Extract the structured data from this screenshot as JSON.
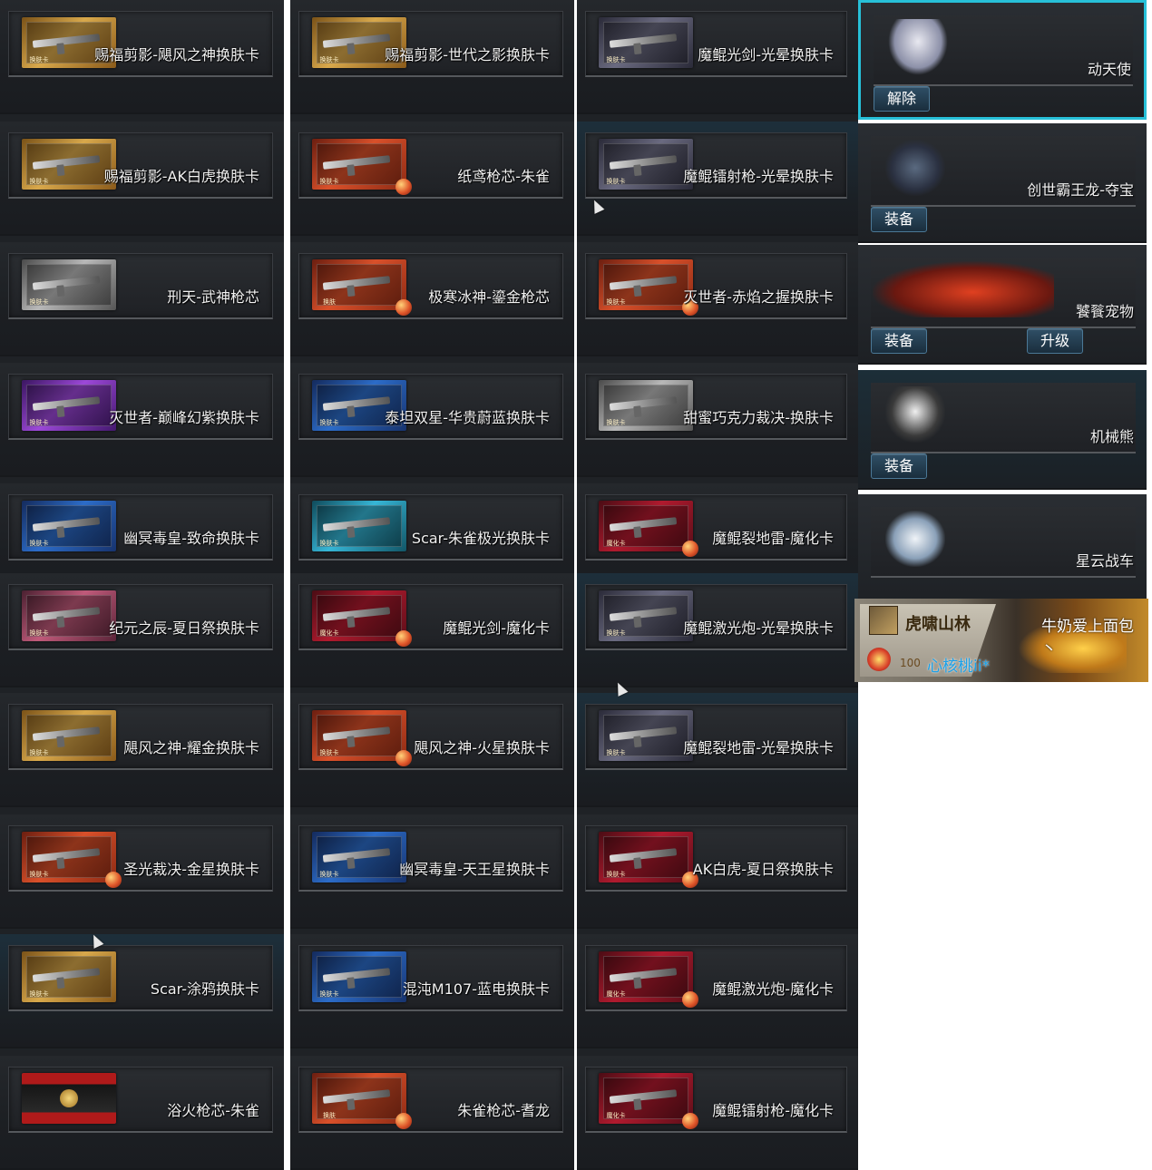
{
  "columns": [
    [
      {
        "label": "赐福剪影-飓风之神换肤卡",
        "theme": "gold",
        "tag": "换肤卡"
      },
      {
        "label": "赐福剪影-AK白虎换肤卡",
        "theme": "gold",
        "tag": "换肤卡"
      },
      {
        "label": "刑天-武神枪芯",
        "theme": "silver",
        "tag": "换肤卡"
      },
      {
        "label": "灭世者-巅峰幻紫换肤卡",
        "theme": "purple",
        "tag": "换肤卡"
      },
      {
        "label": "幽冥毒皇-致命换肤卡",
        "theme": "blue",
        "tag": "换肤卡"
      },
      {
        "label": "纪元之辰-夏日祭换肤卡",
        "theme": "pink",
        "tag": "换肤卡"
      },
      {
        "label": "飓风之神-耀金换肤卡",
        "theme": "gold",
        "tag": "换肤卡"
      },
      {
        "label": "圣光裁决-金星换肤卡",
        "theme": "red",
        "tag": "换肤卡"
      },
      {
        "label": "Scar-涂鸦换肤卡",
        "theme": "gold",
        "tag": "换肤卡"
      },
      {
        "label": "浴火枪芯-朱雀",
        "theme": "crate",
        "tag": ""
      }
    ],
    [
      {
        "label": "赐福剪影-世代之影换肤卡",
        "theme": "gold",
        "tag": "换肤卡"
      },
      {
        "label": "纸鸢枪芯-朱雀",
        "theme": "red",
        "tag": "换肤卡"
      },
      {
        "label": "极寒冰神-鎏金枪芯",
        "theme": "red",
        "tag": "换肤"
      },
      {
        "label": "泰坦双星-华贵蔚蓝换肤卡",
        "theme": "blue",
        "tag": "换肤卡"
      },
      {
        "label": "Scar-朱雀极光换肤卡",
        "theme": "cyan",
        "tag": "换肤卡"
      },
      {
        "label": "魔鲲光剑-魔化卡",
        "theme": "demon",
        "tag": "魔化卡"
      },
      {
        "label": "飓风之神-火星换肤卡",
        "theme": "red",
        "tag": "换肤卡"
      },
      {
        "label": "幽冥毒皇-天王星换肤卡",
        "theme": "blue",
        "tag": "换肤卡"
      },
      {
        "label": "混沌M107-蓝电换肤卡",
        "theme": "blue",
        "tag": "换肤卡"
      },
      {
        "label": "朱雀枪芯-耆龙",
        "theme": "red",
        "tag": "换肤"
      }
    ],
    [
      {
        "label": "魔鲲光剑-光晕换肤卡",
        "theme": "dark",
        "tag": "换肤卡"
      },
      {
        "label": "魔鲲镭射枪-光晕换肤卡",
        "theme": "dark",
        "tag": "换肤卡"
      },
      {
        "label": "灭世者-赤焰之握换肤卡",
        "theme": "red",
        "tag": "换肤卡"
      },
      {
        "label": "甜蜜巧克力裁决-换肤卡",
        "theme": "silver",
        "tag": "换肤卡"
      },
      {
        "label": "魔鲲裂地雷-魔化卡",
        "theme": "demon",
        "tag": "魔化卡"
      },
      {
        "label": "魔鲲激光炮-光晕换肤卡",
        "theme": "dark",
        "tag": "换肤卡"
      },
      {
        "label": "魔鲲裂地雷-光晕换肤卡",
        "theme": "dark",
        "tag": "换肤卡"
      },
      {
        "label": "AK白虎-夏日祭换肤卡",
        "theme": "demon",
        "tag": "换肤卡"
      },
      {
        "label": "魔鲲激光炮-魔化卡",
        "theme": "demon",
        "tag": "魔化卡"
      },
      {
        "label": "魔鲲镭射枪-魔化卡",
        "theme": "demon",
        "tag": "魔化卡"
      }
    ]
  ],
  "pets": [
    {
      "name": "动天使",
      "buttons": [
        "解除"
      ],
      "selected": true
    },
    {
      "name": "创世霸王龙-夺宝",
      "buttons": [
        "装备"
      ],
      "selected": false
    },
    {
      "name": "饕餮宠物",
      "buttons": [
        "装备",
        "升级"
      ],
      "selected": false
    },
    {
      "name": "机械熊",
      "buttons": [
        "装备"
      ],
      "selected": false
    },
    {
      "name": "星云战车",
      "buttons": [],
      "selected": false
    }
  ],
  "banner": {
    "guild": "虎啸山林",
    "level": "100",
    "nickname": "心核桃ii*",
    "message": "牛奶爱上面包丶"
  },
  "colors": {
    "selection_border": "#27c0d8",
    "nickname": "#1aa0e8",
    "button_bg": "#2f4f66"
  }
}
